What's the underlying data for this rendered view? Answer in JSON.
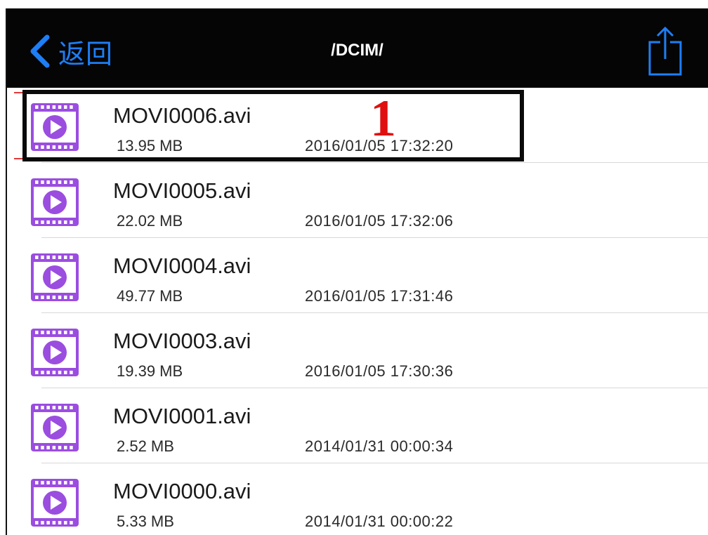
{
  "navbar": {
    "back_label": "返回",
    "title": "/DCIM/",
    "back_icon": "chevron-left-icon",
    "share_icon": "share-icon"
  },
  "colors": {
    "navbar_bg": "#050505",
    "accent_blue": "#1e7ef5",
    "icon_purple": "#9b4de0",
    "callout_red": "#e01010"
  },
  "files": [
    {
      "name": "MOVI0006.avi",
      "size": "13.95 MB",
      "date": "2016/01/05 17:32:20",
      "icon": "video-file-icon"
    },
    {
      "name": "MOVI0005.avi",
      "size": "22.02 MB",
      "date": "2016/01/05 17:32:06",
      "icon": "video-file-icon"
    },
    {
      "name": "MOVI0004.avi",
      "size": "49.77 MB",
      "date": "2016/01/05 17:31:46",
      "icon": "video-file-icon"
    },
    {
      "name": "MOVI0003.avi",
      "size": "19.39 MB",
      "date": "2016/01/05 17:30:36",
      "icon": "video-file-icon"
    },
    {
      "name": "MOVI0001.avi",
      "size": "2.52 MB",
      "date": "2014/01/31 00:00:34",
      "icon": "video-file-icon"
    },
    {
      "name": "MOVI0000.avi",
      "size": "5.33 MB",
      "date": "2014/01/31 00:00:22",
      "icon": "video-file-icon"
    }
  ],
  "annotation": {
    "callout_number": "1"
  }
}
